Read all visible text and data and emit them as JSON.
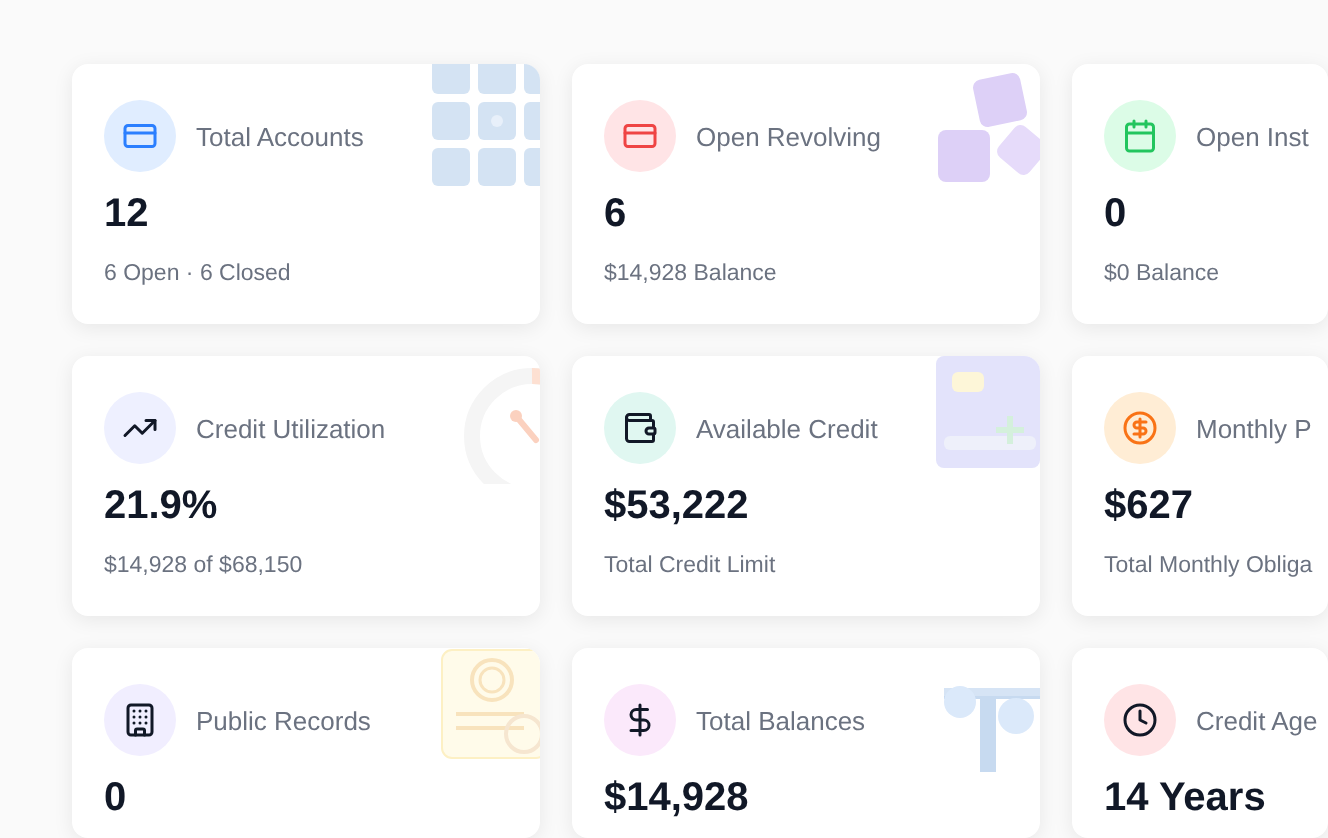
{
  "cards": [
    {
      "title": "Total Accounts",
      "value": "12",
      "subtitle": "6 Open · 6 Closed"
    },
    {
      "title": "Open Revolving",
      "value": "6",
      "subtitle": "$14,928 Balance"
    },
    {
      "title": "Open Inst",
      "value": "0",
      "subtitle": "$0 Balance"
    },
    {
      "title": "Credit Utilization",
      "value": "21.9%",
      "subtitle": "$14,928 of $68,150"
    },
    {
      "title": "Available Credit",
      "value": "$53,222",
      "subtitle": "Total Credit Limit"
    },
    {
      "title": "Monthly P",
      "value": "$627",
      "subtitle": "Total Monthly Obliga"
    },
    {
      "title": "Public Records",
      "value": "0"
    },
    {
      "title": "Total Balances",
      "value": "$14,928"
    },
    {
      "title": "Credit Age",
      "value": "14 Years"
    }
  ]
}
